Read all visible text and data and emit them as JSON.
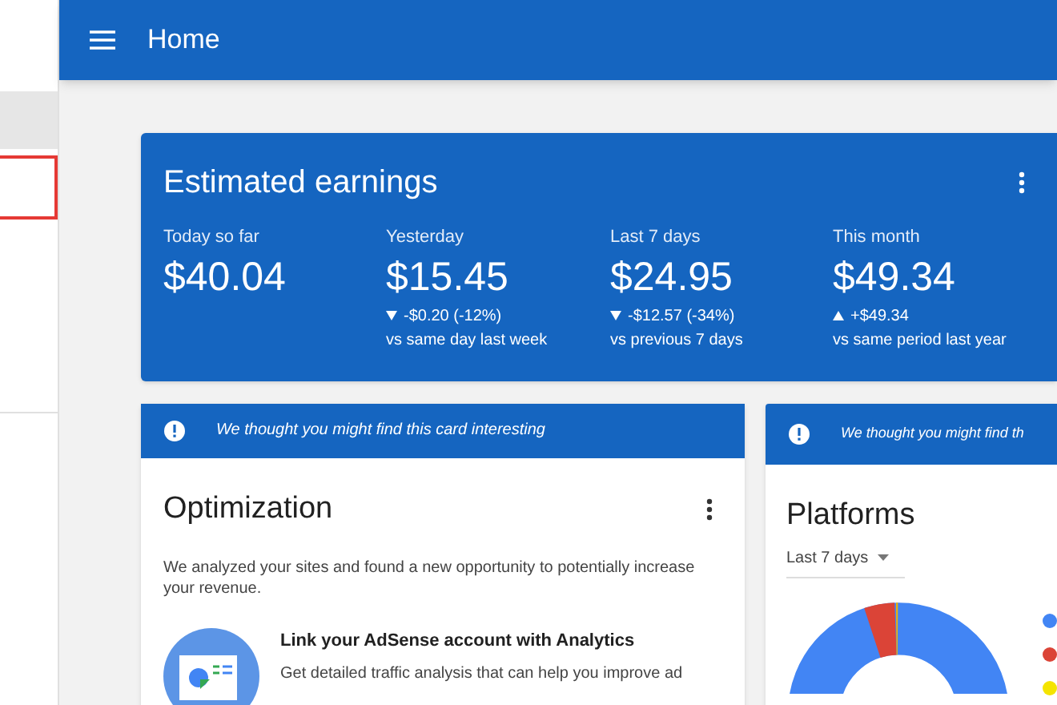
{
  "top_bar": {
    "title": "Home"
  },
  "earnings": {
    "title": "Estimated earnings",
    "stats": [
      {
        "label": "Today so far",
        "value": "$40.04"
      },
      {
        "label": "Yesterday",
        "value": "$15.45",
        "kind": "decrease",
        "change": "-$0.20 (-12%)",
        "compare": "vs same day last week"
      },
      {
        "label": "Last 7 days",
        "value": "$24.95",
        "kind": "decrease",
        "change": "-$12.57 (-34%)",
        "compare": "vs previous 7 days"
      },
      {
        "label": "This month",
        "value": "$49.34",
        "kind": "increase",
        "change": "+$49.34",
        "compare": "vs same period last year"
      }
    ]
  },
  "optimization_card": {
    "banner": "We thought you might find this card interesting",
    "title": "Optimization",
    "description": "We analyzed your sites and found a new opportunity to potentially increase your revenue.",
    "tip_title": "Link your AdSense account with Analytics",
    "tip_text": "Get detailed traffic analysis that can help you improve ad"
  },
  "platforms_card": {
    "banner": "We thought you might find th",
    "title": "Platforms",
    "period": "Last 7 days"
  }
}
